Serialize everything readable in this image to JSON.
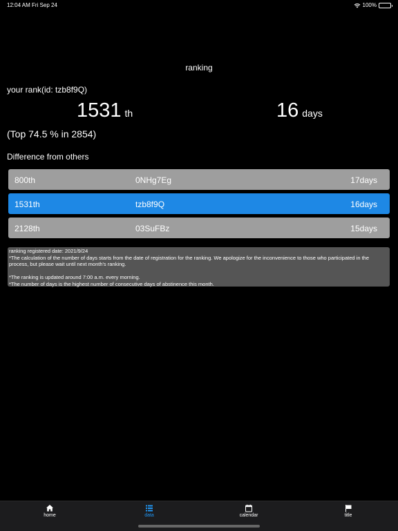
{
  "status": {
    "time": "12:04 AM",
    "date": "Fri Sep 24",
    "battery": "100%",
    "battery_level": 1.0
  },
  "nav": {
    "title": "ranking"
  },
  "rank": {
    "your_rank_label": "your rank(id: tzb8f9Q)",
    "position": "1531",
    "position_suffix": "th",
    "days": "16",
    "days_suffix": "days",
    "top_percent": "(Top 74.5 % in 2854)"
  },
  "difference": {
    "heading": "Difference from others",
    "rows": [
      {
        "rank": "800th",
        "id": "0NHg7Eg",
        "days": "17days",
        "active": false
      },
      {
        "rank": "1531th",
        "id": "tzb8f9Q",
        "days": "16days",
        "active": true
      },
      {
        "rank": "2128th",
        "id": "03SuFBz",
        "days": "15days",
        "active": false
      }
    ]
  },
  "notes": {
    "text": "ranking registered date: 2021/9/24\n*The calculation of the number of days starts from the date of registration for the ranking. We apologize for the inconvenience to those who participated in the process, but please wait until next month's ranking.\n\n*The ranking is updated around 7:00 a.m. every morning.\n*The number of days is the highest number of consecutive days of abstinence this month."
  },
  "tabs": [
    {
      "label": "home",
      "icon": "home-icon"
    },
    {
      "label": "data",
      "icon": "list-icon"
    },
    {
      "label": "calendar",
      "icon": "calendar-icon"
    },
    {
      "label": "title",
      "icon": "flag-icon"
    }
  ],
  "colors": {
    "accent": "#2196f3",
    "active_row": "#1e88e5",
    "row": "#9e9e9e",
    "notes_bg": "#555555"
  }
}
